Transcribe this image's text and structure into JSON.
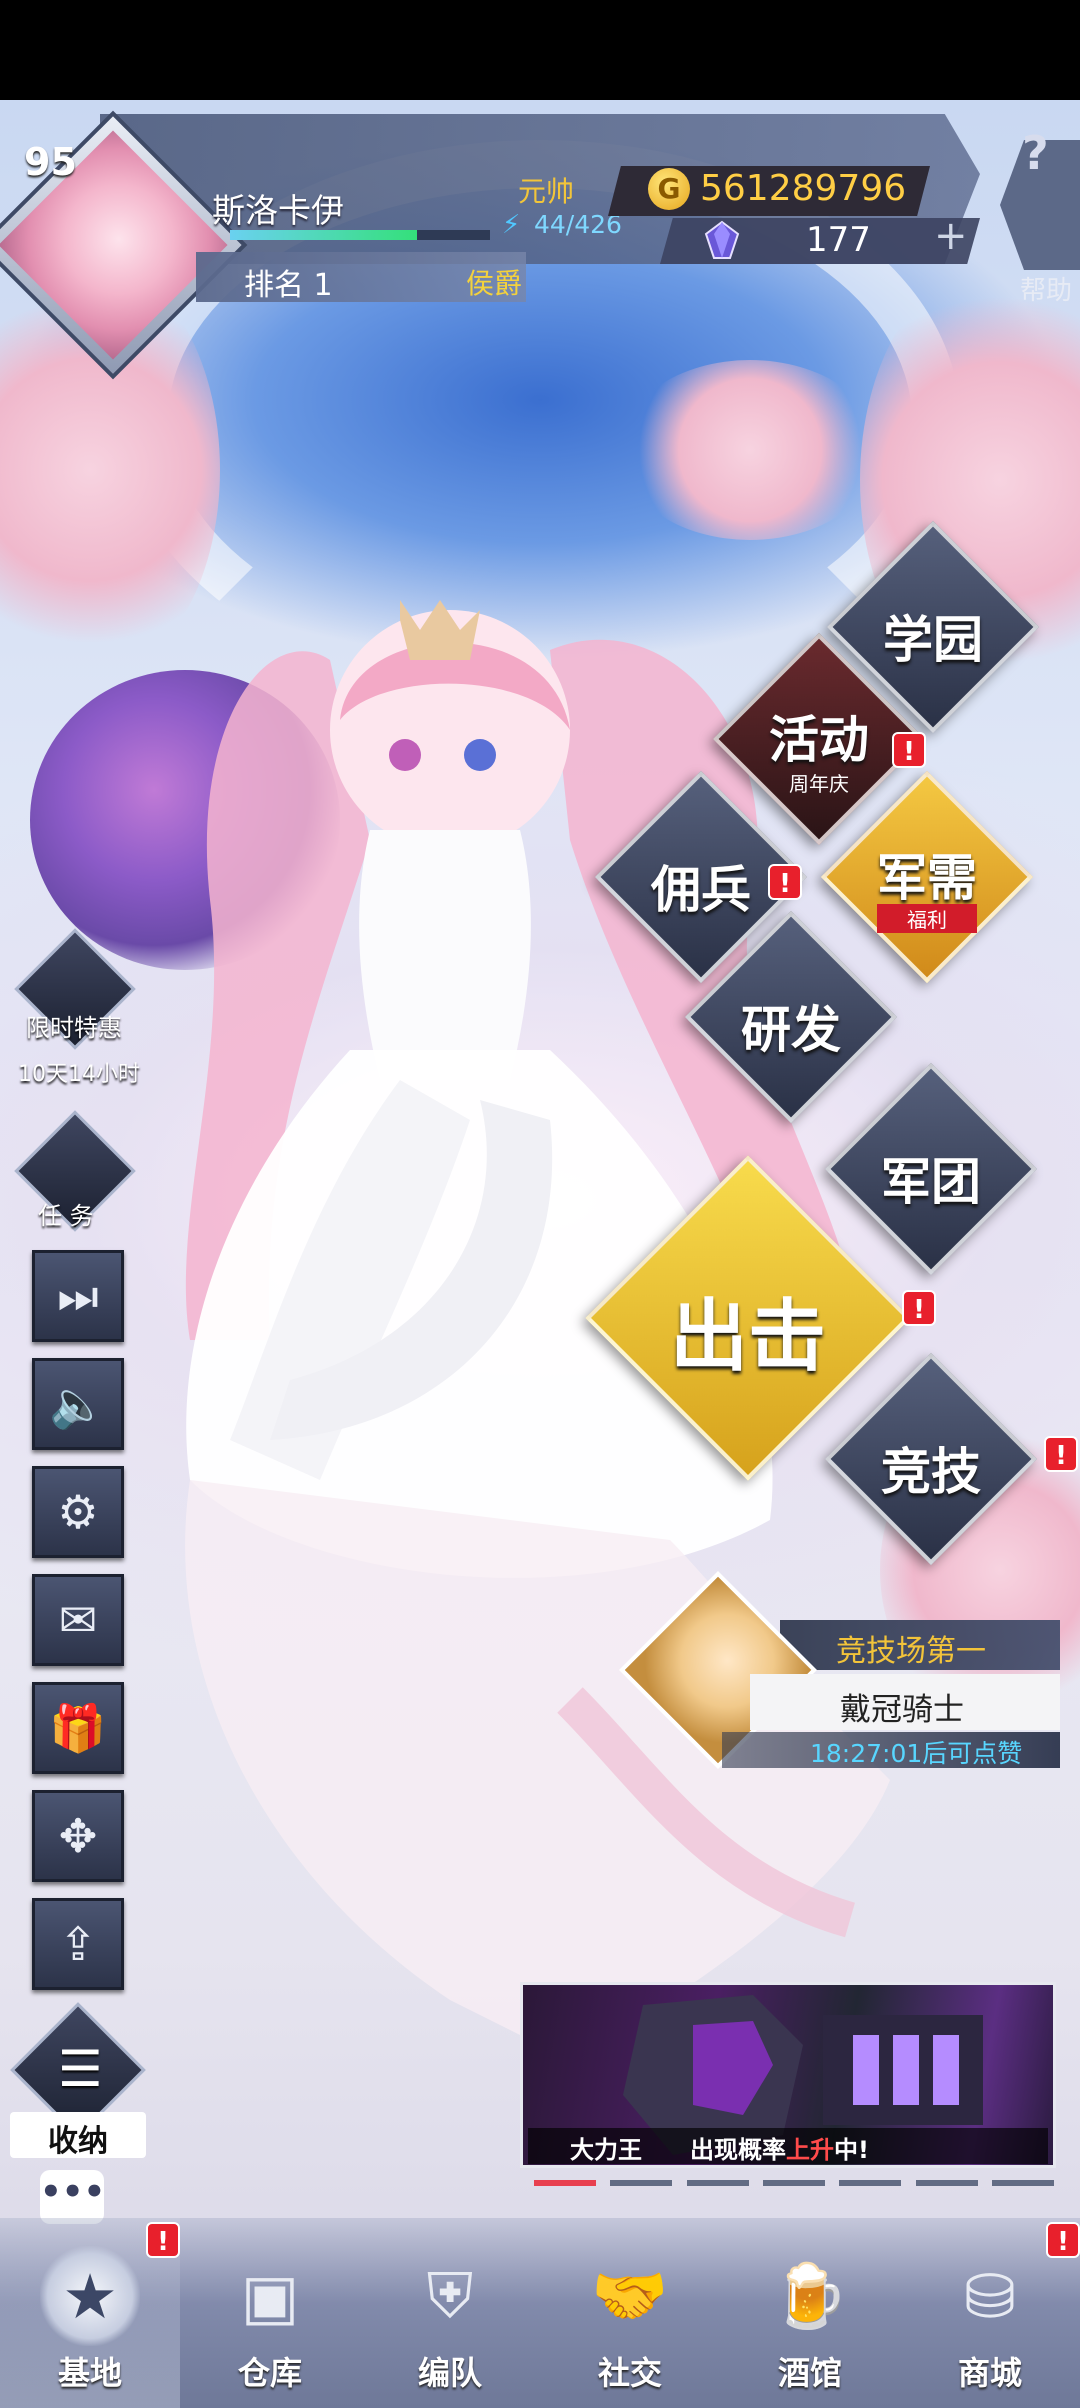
{
  "player": {
    "level": "95",
    "name": "斯洛卡伊",
    "rank_label": "排名 1",
    "noble_title": "侯爵",
    "military_rank": "元帅",
    "energy": "44/426",
    "exp_fraction": 0.72
  },
  "currency": {
    "gold": "561289796",
    "gold_icon_glyph": "G",
    "gems": "177",
    "plus_glyph": "+"
  },
  "help": {
    "icon": "?",
    "label": "帮助"
  },
  "menu": {
    "academy": "学园",
    "event": "活动",
    "event_sub": "周年庆",
    "mercenary": "佣兵",
    "supply": "军需",
    "supply_sub": "福利",
    "research": "研发",
    "legion": "军团",
    "sortie": "出击",
    "arena": "竞技"
  },
  "badge_glyph": "!",
  "side": {
    "limited_offer": "限时特惠",
    "offer_timer": "10天14小时",
    "tasks": "任 务",
    "collapse": "收纳",
    "chat_glyph": "•••",
    "icons": {
      "skip": "⏭",
      "sound": "🔈",
      "settings": "⚙",
      "mail": "✉",
      "gift": "🎁",
      "move": "✥",
      "upload": "⇪",
      "collapse": "☰"
    }
  },
  "arena_champion": {
    "title": "竞技场第一",
    "name": "戴冠骑士",
    "timer": "18:27:01后可点赞"
  },
  "banner": {
    "name": "大力王",
    "text_before": "出现概率",
    "text_highlight": "上升",
    "text_after": "中!",
    "slides": 7,
    "active_slide": 1
  },
  "nav": [
    {
      "label": "基地",
      "icon": "★",
      "active": true
    },
    {
      "label": "仓库",
      "icon": "▣",
      "active": false
    },
    {
      "label": "编队",
      "icon": "⛨",
      "active": false
    },
    {
      "label": "社交",
      "icon": "🤝",
      "active": false
    },
    {
      "label": "酒馆",
      "icon": "🍺",
      "active": false
    },
    {
      "label": "商城",
      "icon": "⛁",
      "active": false
    }
  ],
  "colors": {
    "gold_text": "#ffce45",
    "rank_yellow": "#f4d23c",
    "alert_red": "#e8202c",
    "timer_cyan": "#58d6ff"
  }
}
